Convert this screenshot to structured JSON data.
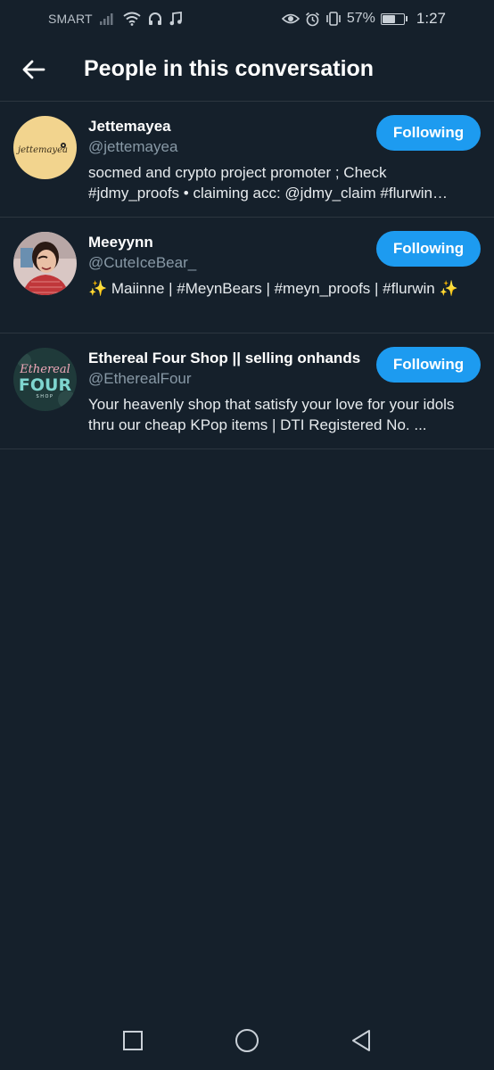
{
  "status_bar": {
    "carrier": "SMART",
    "battery_percent": "57%",
    "battery_level": 0.57,
    "time": "1:27",
    "icons": [
      "signal-icon",
      "wifi-icon",
      "headphones-icon",
      "music-icon",
      "eye-icon",
      "alarm-icon",
      "vibrate-icon",
      "battery-icon"
    ]
  },
  "header": {
    "title": "People in this conversation"
  },
  "users": [
    {
      "name": "Jettemayea",
      "handle": "@jettemayea",
      "bio": "socmed and crypto project promoter ; Check #jdmy_proofs • claiming acc: @jdmy_claim #flurwin #flurwinproofs",
      "button_label": "Following",
      "avatar_text": "jettemayea",
      "avatar_color": "#f2d48e"
    },
    {
      "name": "Meeyynn",
      "handle": "@CuteIceBear_",
      "bio": "✨ Maiinne  | #MeynBears | #meyn_proofs  |  #flurwin ✨",
      "button_label": "Following",
      "avatar_color": "#c84a4a"
    },
    {
      "name": "Ethereal Four Shop || selling onhands",
      "handle": "@EtherealFour",
      "bio": "Your heavenly shop that satisfy your love for your idols thru our cheap KPop items | DTI Registered No. ...",
      "button_label": "Following",
      "avatar_text_1": "Ethereal",
      "avatar_text_2": "FOUR",
      "avatar_text_3": "SHOP",
      "avatar_color": "#1f3a3a"
    }
  ],
  "colors": {
    "background": "#15202b",
    "accent": "#1d9bf0",
    "divider": "#2c3640",
    "secondary_text": "#8899a6"
  }
}
